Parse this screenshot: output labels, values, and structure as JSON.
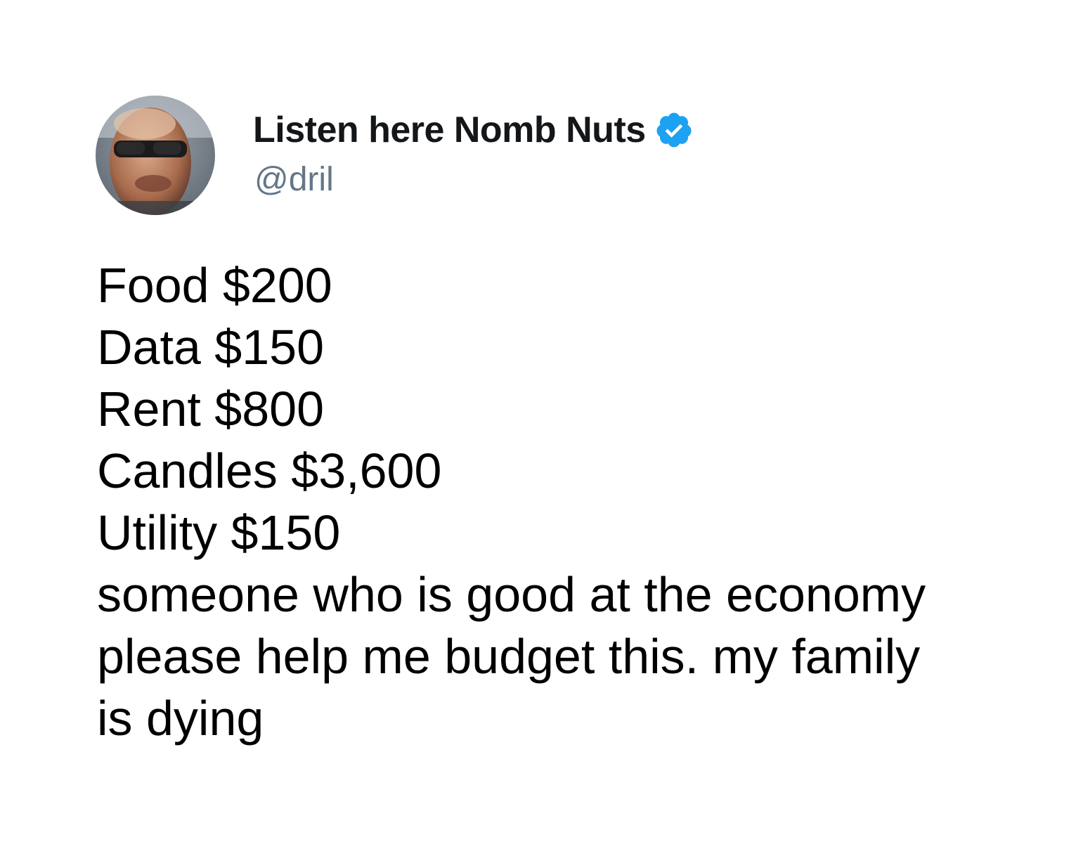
{
  "author": {
    "display_name": "Listen here Nomb Nuts",
    "handle": "@dril",
    "verified": true,
    "avatar_icon": "profile-photo",
    "verified_icon": "verified-badge-icon",
    "verified_color": "#1da1f2"
  },
  "tweet": {
    "lines": [
      "Food $200",
      "Data $150",
      "Rent $800",
      "Candles $3,600",
      "Utility $150",
      "someone who is good at the economy",
      "please help me budget this. my family",
      "is dying"
    ]
  }
}
